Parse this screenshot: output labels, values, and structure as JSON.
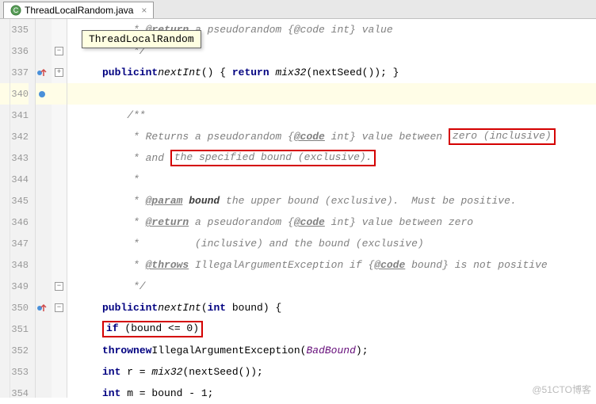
{
  "tab": {
    "filename": "ThreadLocalRandom.java",
    "close": "×"
  },
  "tooltip": "ThreadLocalRandom",
  "lines": {
    "l335": {
      "num": "335",
      "c1": "     * ",
      "tag": "@return",
      "c2": " a pseudorandom {@code int} value"
    },
    "l336": {
      "num": "336",
      "c": "     */"
    },
    "l337": {
      "num": "337",
      "kw1": "public",
      "kw2": "int",
      "m1": "nextInt",
      "p1": "() { ",
      "kw3": "return",
      "m2": " mix32",
      "m3": "(nextSeed()); }"
    },
    "l340": {
      "num": "340"
    },
    "l341": {
      "num": "341",
      "c": "    /**"
    },
    "l342": {
      "num": "342",
      "c1": "     * Returns a pseudorandom {",
      "tag": "@code",
      "c2": " int} value between ",
      "hl": "zero (inclusive)"
    },
    "l343": {
      "num": "343",
      "c1": "     * and ",
      "hl": "the specified bound (exclusive)."
    },
    "l344": {
      "num": "344",
      "c": "     *"
    },
    "l345": {
      "num": "345",
      "c1": "     * ",
      "tag": "@param",
      "p": " bound",
      "c2": " the upper bound (exclusive).  Must be positive."
    },
    "l346": {
      "num": "346",
      "c1": "     * ",
      "tag": "@return",
      "c2": " a pseudorandom {",
      "tag2": "@code",
      "c3": " int} value between zero"
    },
    "l347": {
      "num": "347",
      "c": "     *         (inclusive) and the bound (exclusive)"
    },
    "l348": {
      "num": "348",
      "c1": "     * ",
      "tag": "@throws",
      "c2": " IllegalArgumentException if {",
      "tag2": "@code",
      "c3": " bound} is not positive"
    },
    "l349": {
      "num": "349",
      "c": "     */"
    },
    "l350": {
      "num": "350",
      "kw1": "public",
      "kw2": "int",
      "m": "nextInt",
      "p1": "(",
      "kw3": "int",
      "p2": " bound) {"
    },
    "l351": {
      "num": "351",
      "kw": "if",
      "body": " (bound <= 0)"
    },
    "l352": {
      "num": "352",
      "kw1": "throw",
      "kw2": "new",
      "cls": "IllegalArgumentException",
      "p": "(",
      "id": "BadBound",
      "p2": ");"
    },
    "l353": {
      "num": "353",
      "kw": "int",
      "v": " r = ",
      "m": "mix32",
      "p": "(nextSeed());"
    },
    "l354": {
      "num": "354",
      "kw": "int",
      "body": " m = bound - 1;"
    }
  },
  "watermark": "@51CTO博客"
}
